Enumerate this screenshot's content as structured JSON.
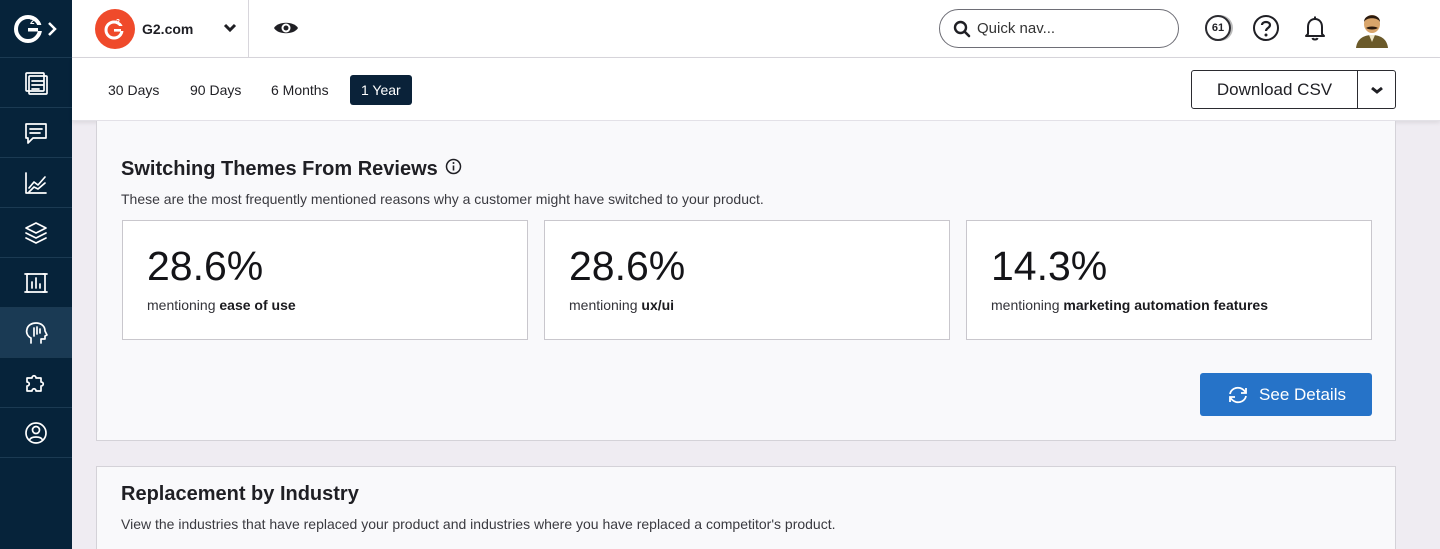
{
  "sidebar": {
    "logo_icon": "g2-logo-icon",
    "items": [
      {
        "icon": "dashboard-icon",
        "active": false
      },
      {
        "icon": "chat-icon",
        "active": false
      },
      {
        "icon": "line-chart-icon",
        "active": false
      },
      {
        "icon": "layers-icon",
        "active": false
      },
      {
        "icon": "bar-chart-frame-icon",
        "active": false
      },
      {
        "icon": "head-insights-icon",
        "active": true
      },
      {
        "icon": "puzzle-icon",
        "active": false
      },
      {
        "icon": "user-circle-icon",
        "active": false
      }
    ]
  },
  "header": {
    "brand_name": "G2.com",
    "brand_color": "#ef4a2b",
    "search_placeholder": "Quick nav...",
    "notification_count": "61"
  },
  "filters": {
    "ranges": [
      {
        "label": "30 Days",
        "active": false
      },
      {
        "label": "90 Days",
        "active": false
      },
      {
        "label": "6 Months",
        "active": false
      },
      {
        "label": "1 Year",
        "active": true
      }
    ],
    "download_label": "Download CSV"
  },
  "switching_themes": {
    "title": "Switching Themes From Reviews",
    "description": "These are the most frequently mentioned reasons why a customer might have switched to your product.",
    "stats": [
      {
        "value": "28.6%",
        "prefix": "mentioning",
        "theme": "ease of use"
      },
      {
        "value": "28.6%",
        "prefix": "mentioning",
        "theme": "ux/ui"
      },
      {
        "value": "14.3%",
        "prefix": "mentioning",
        "theme": "marketing automation features"
      }
    ],
    "details_label": "See Details",
    "accent_color": "#2673c8"
  },
  "replacement_by_industry": {
    "title": "Replacement by Industry",
    "description": "View the industries that have replaced your product and industries where you have replaced a competitor's product."
  }
}
